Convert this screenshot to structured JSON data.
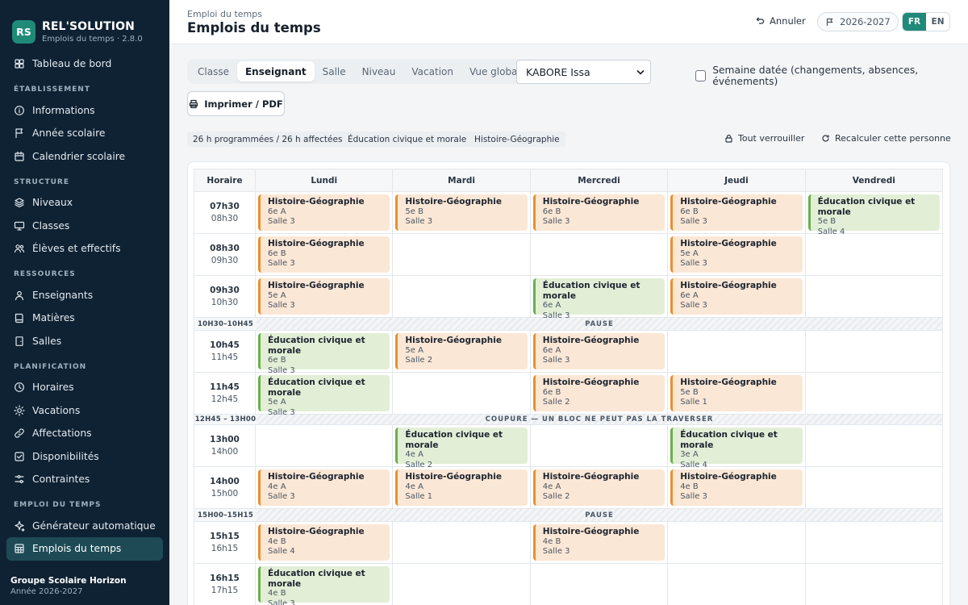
{
  "app": {
    "logo": "RS",
    "name": "REL'SOLUTION",
    "subtitle": "Emplois du temps · 2.8.0"
  },
  "sidebar": {
    "top": [
      {
        "label": "Tableau de bord",
        "icon": "grid-icon"
      }
    ],
    "sections": [
      {
        "title": "ÉTABLISSEMENT",
        "items": [
          {
            "label": "Informations",
            "icon": "info-icon"
          },
          {
            "label": "Année scolaire",
            "icon": "flag-icon"
          },
          {
            "label": "Calendrier scolaire",
            "icon": "calendar-icon"
          }
        ]
      },
      {
        "title": "STRUCTURE",
        "items": [
          {
            "label": "Niveaux",
            "icon": "layers-icon"
          },
          {
            "label": "Classes",
            "icon": "monitor-icon"
          },
          {
            "label": "Élèves et effectifs",
            "icon": "users-icon"
          }
        ]
      },
      {
        "title": "RESSOURCES",
        "items": [
          {
            "label": "Enseignants",
            "icon": "user-icon"
          },
          {
            "label": "Matières",
            "icon": "book-icon"
          },
          {
            "label": "Salles",
            "icon": "door-icon"
          }
        ]
      },
      {
        "title": "PLANIFICATION",
        "items": [
          {
            "label": "Horaires",
            "icon": "clock-icon"
          },
          {
            "label": "Vacations",
            "icon": "sun-icon"
          },
          {
            "label": "Affectations",
            "icon": "link-icon"
          },
          {
            "label": "Disponibilités",
            "icon": "check-square-icon"
          },
          {
            "label": "Contraintes",
            "icon": "sliders-icon"
          }
        ]
      },
      {
        "title": "EMPLOI DU TEMPS",
        "items": [
          {
            "label": "Générateur automatique",
            "icon": "sparkle-icon"
          },
          {
            "label": "Emplois du temps",
            "icon": "table-icon",
            "active": true
          }
        ]
      }
    ],
    "footer": {
      "org": "Groupe Scolaire Horizon",
      "year": "Année 2026-2027"
    }
  },
  "header": {
    "breadcrumb": "Emploi du temps",
    "title": "Emplois du temps",
    "undo_label": "Annuler",
    "year": "2026-2027",
    "lang": [
      "FR",
      "EN"
    ],
    "lang_active": "FR"
  },
  "controls": {
    "tabs": [
      "Classe",
      "Enseignant",
      "Salle",
      "Niveau",
      "Vacation",
      "Vue globale"
    ],
    "active_tab": "Enseignant",
    "teacher_select": "KABORE Issa",
    "dated_week_label": "Semaine datée (changements, absences, événements)",
    "dated_week_checked": false,
    "print_label": "Imprimer / PDF"
  },
  "summary": {
    "hours": "26 h programmées / 26 h affectées",
    "subjects": [
      "Éducation civique et morale",
      "Histoire-Géographie"
    ],
    "lock_all": "Tout verrouiller",
    "recalc": "Recalculer cette personne"
  },
  "timetable": {
    "header_time": "Horaire",
    "days": [
      "Lundi",
      "Mardi",
      "Mercredi",
      "Jeudi",
      "Vendredi"
    ],
    "rows": [
      {
        "kind": "slot",
        "start": "07h30",
        "end": "08h30",
        "cells": [
          {
            "subject": "Histoire-Géographie",
            "class": "6e A",
            "room": "Salle 3",
            "type": "hg"
          },
          {
            "subject": "Histoire-Géographie",
            "class": "5e B",
            "room": "Salle 3",
            "type": "hg"
          },
          {
            "subject": "Histoire-Géographie",
            "class": "6e B",
            "room": "Salle 3",
            "type": "hg"
          },
          {
            "subject": "Histoire-Géographie",
            "class": "6e B",
            "room": "Salle 3",
            "type": "hg"
          },
          {
            "subject": "Éducation civique et morale",
            "class": "5e B",
            "room": "Salle 4",
            "type": "ecm"
          }
        ]
      },
      {
        "kind": "slot",
        "start": "08h30",
        "end": "09h30",
        "cells": [
          {
            "subject": "Histoire-Géographie",
            "class": "6e B",
            "room": "Salle 3",
            "type": "hg"
          },
          null,
          null,
          {
            "subject": "Histoire-Géographie",
            "class": "5e A",
            "room": "Salle 3",
            "type": "hg"
          },
          null
        ]
      },
      {
        "kind": "slot",
        "start": "09h30",
        "end": "10h30",
        "cells": [
          {
            "subject": "Histoire-Géographie",
            "class": "5e A",
            "room": "Salle 3",
            "type": "hg"
          },
          null,
          {
            "subject": "Éducation civique et morale",
            "class": "6e A",
            "room": "Salle 3",
            "type": "ecm"
          },
          {
            "subject": "Histoire-Géographie",
            "class": "6e A",
            "room": "Salle 3",
            "type": "hg"
          },
          null
        ]
      },
      {
        "kind": "break",
        "time": "10H30–10H45",
        "label": "PAUSE"
      },
      {
        "kind": "slot",
        "start": "10h45",
        "end": "11h45",
        "cells": [
          {
            "subject": "Éducation civique et morale",
            "class": "6e B",
            "room": "Salle 3",
            "type": "ecm"
          },
          {
            "subject": "Histoire-Géographie",
            "class": "5e A",
            "room": "Salle 2",
            "type": "hg"
          },
          {
            "subject": "Histoire-Géographie",
            "class": "6e A",
            "room": "Salle 3",
            "type": "hg"
          },
          null,
          null
        ]
      },
      {
        "kind": "slot",
        "start": "11h45",
        "end": "12h45",
        "cells": [
          {
            "subject": "Éducation civique et morale",
            "class": "5e A",
            "room": "Salle 3",
            "type": "ecm"
          },
          null,
          {
            "subject": "Histoire-Géographie",
            "class": "6e B",
            "room": "Salle 2",
            "type": "hg"
          },
          {
            "subject": "Histoire-Géographie",
            "class": "5e B",
            "room": "Salle 1",
            "type": "hg"
          },
          null
        ]
      },
      {
        "kind": "break",
        "time": "12H45 – 13H00",
        "label": "COUPURE — UN BLOC NE PEUT PAS LA TRAVERSER"
      },
      {
        "kind": "slot",
        "start": "13h00",
        "end": "14h00",
        "cells": [
          null,
          {
            "subject": "Éducation civique et morale",
            "class": "4e A",
            "room": "Salle 2",
            "type": "ecm"
          },
          null,
          {
            "subject": "Éducation civique et morale",
            "class": "3e A",
            "room": "Salle 4",
            "type": "ecm"
          },
          null
        ]
      },
      {
        "kind": "slot",
        "start": "14h00",
        "end": "15h00",
        "cells": [
          {
            "subject": "Histoire-Géographie",
            "class": "4e A",
            "room": "Salle 3",
            "type": "hg"
          },
          {
            "subject": "Histoire-Géographie",
            "class": "4e A",
            "room": "Salle 1",
            "type": "hg"
          },
          {
            "subject": "Histoire-Géographie",
            "class": "4e A",
            "room": "Salle 2",
            "type": "hg"
          },
          {
            "subject": "Histoire-Géographie",
            "class": "4e B",
            "room": "Salle 3",
            "type": "hg"
          },
          null
        ]
      },
      {
        "kind": "break",
        "time": "15H00–15H15",
        "label": "PAUSE"
      },
      {
        "kind": "slot",
        "start": "15h15",
        "end": "16h15",
        "cells": [
          {
            "subject": "Histoire-Géographie",
            "class": "4e B",
            "room": "Salle 4",
            "type": "hg"
          },
          null,
          {
            "subject": "Histoire-Géographie",
            "class": "4e B",
            "room": "Salle 3",
            "type": "hg"
          },
          null,
          null
        ]
      },
      {
        "kind": "slot",
        "start": "16h15",
        "end": "17h15",
        "cells": [
          {
            "subject": "Éducation civique et morale",
            "class": "4e B",
            "room": "Salle 3",
            "type": "ecm"
          },
          null,
          null,
          null,
          null
        ]
      }
    ]
  }
}
